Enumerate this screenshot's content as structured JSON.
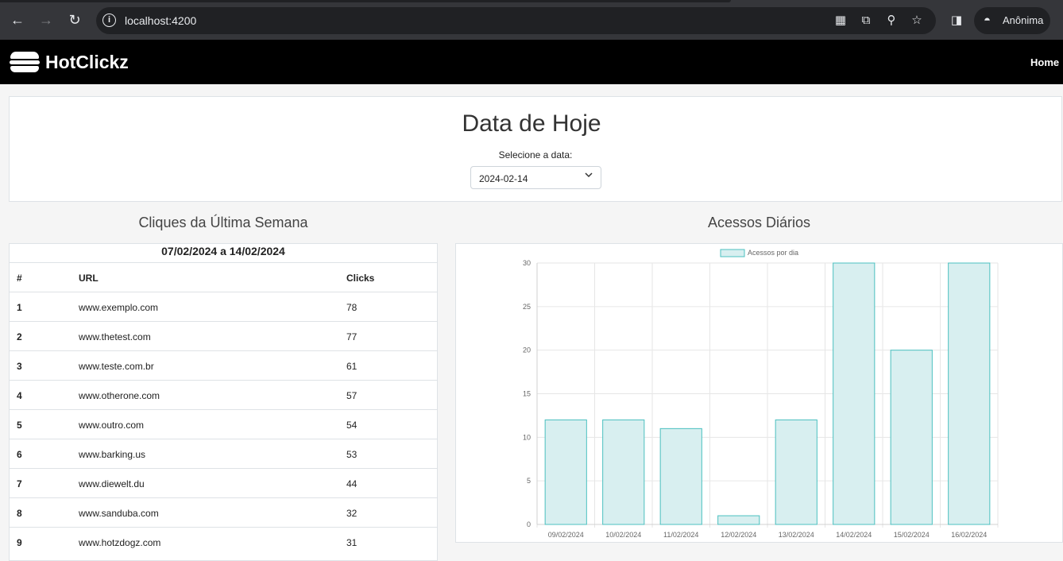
{
  "browser": {
    "url": "localhost:4200",
    "profile_label": "Anônima"
  },
  "navbar": {
    "brand": "HotClickz",
    "home_link": "Home"
  },
  "date_panel": {
    "title": "Data de Hoje",
    "label": "Selecione a data:",
    "selected_date": "2024-02-14"
  },
  "weekly_clicks": {
    "title": "Cliques da Última Semana",
    "range": "07/02/2024 a 14/02/2024",
    "headers": [
      "#",
      "URL",
      "Clicks"
    ],
    "rows": [
      {
        "idx": "1",
        "url": "www.exemplo.com",
        "clicks": "78"
      },
      {
        "idx": "2",
        "url": "www.thetest.com",
        "clicks": "77"
      },
      {
        "idx": "3",
        "url": "www.teste.com.br",
        "clicks": "61"
      },
      {
        "idx": "4",
        "url": "www.otherone.com",
        "clicks": "57"
      },
      {
        "idx": "5",
        "url": "www.outro.com",
        "clicks": "54"
      },
      {
        "idx": "6",
        "url": "www.barking.us",
        "clicks": "53"
      },
      {
        "idx": "7",
        "url": "www.diewelt.du",
        "clicks": "44"
      },
      {
        "idx": "8",
        "url": "www.sanduba.com",
        "clicks": "32"
      },
      {
        "idx": "9",
        "url": "www.hotzdogz.com",
        "clicks": "31"
      }
    ]
  },
  "daily_access": {
    "title": "Acessos Diários"
  },
  "colors": {
    "bar_fill": "#d8eff0",
    "bar_stroke": "#4bc0c0",
    "navbar": "#000000",
    "chrome": "#35363a"
  },
  "chart_data": {
    "type": "bar",
    "categories": [
      "09/02/2024",
      "10/02/2024",
      "11/02/2024",
      "12/02/2024",
      "13/02/2024",
      "14/02/2024",
      "15/02/2024",
      "16/02/2024"
    ],
    "series": [
      {
        "name": "Acessos por dia",
        "values": [
          12,
          12,
          11,
          1,
          12,
          30,
          20,
          30
        ]
      }
    ],
    "ylim": [
      0,
      30
    ],
    "yticks": [
      0,
      5,
      10,
      15,
      20,
      25,
      30
    ],
    "grid": true,
    "legend": "top-center"
  }
}
